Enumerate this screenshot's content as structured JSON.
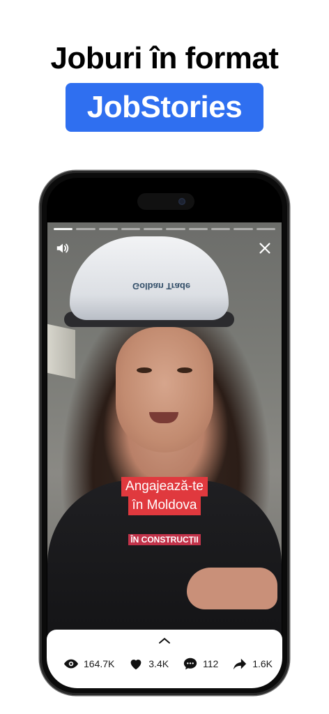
{
  "headline": "Joburi în format",
  "badge": {
    "text": "JobStories",
    "color": "#2f6ff0"
  },
  "story": {
    "segments": 10,
    "active_segment": 1,
    "helmet_logo": "Golban Trade",
    "captions": [
      "Angajează-te",
      "în Moldova"
    ],
    "tag": "ÎN CONSTRUCȚII",
    "icons": {
      "sound": "speaker-icon",
      "close": "close-icon"
    }
  },
  "stats": {
    "views": "164.7K",
    "likes": "3.4K",
    "comments": "112",
    "shares": "1.6K"
  }
}
